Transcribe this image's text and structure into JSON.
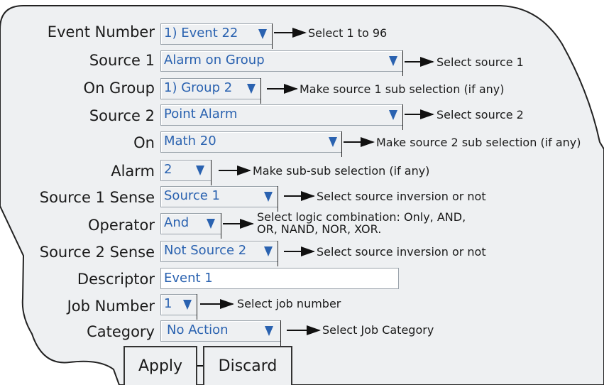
{
  "form": {
    "event_number": {
      "label": "Event Number",
      "value": "1) Event 22",
      "hint": "Select 1 to 96"
    },
    "source1": {
      "label": "Source 1",
      "value": "Alarm on Group",
      "hint": "Select source 1"
    },
    "on_group": {
      "label": "On Group",
      "value": "1) Group 2",
      "hint": "Make source 1 sub selection (if any)"
    },
    "source2": {
      "label": "Source 2",
      "value": "Point Alarm",
      "hint": "Select source 2"
    },
    "on": {
      "label": "On",
      "value": "Math 20",
      "hint": "Make source 2 sub selection (if any)"
    },
    "alarm": {
      "label": "Alarm",
      "value": "2",
      "hint": "Make sub-sub selection (if any)"
    },
    "source1_sense": {
      "label": "Source 1 Sense",
      "value": "Source 1",
      "hint": "Select source inversion or not"
    },
    "operator": {
      "label": "Operator",
      "value": "And",
      "hint_line1": "Select logic combination: Only, AND,",
      "hint_line2": "OR, NAND, NOR, XOR."
    },
    "source2_sense": {
      "label": "Source 2 Sense",
      "value": "Not Source 2",
      "hint": "Select source inversion or not"
    },
    "descriptor": {
      "label": "Descriptor",
      "value": "Event 1"
    },
    "job_number": {
      "label": "Job Number",
      "value": "1",
      "hint": "Select job number"
    },
    "category": {
      "label": "Category",
      "value": "No Action",
      "hint": "Select Job Category"
    }
  },
  "buttons": {
    "apply": "Apply",
    "discard": "Discard"
  },
  "icons": {
    "dropdown": "dropdown-arrow-icon",
    "pointer": "pointer-arrow-icon"
  },
  "colors": {
    "value_text": "#2a62b0",
    "panel_fill": "#eef0f2"
  }
}
